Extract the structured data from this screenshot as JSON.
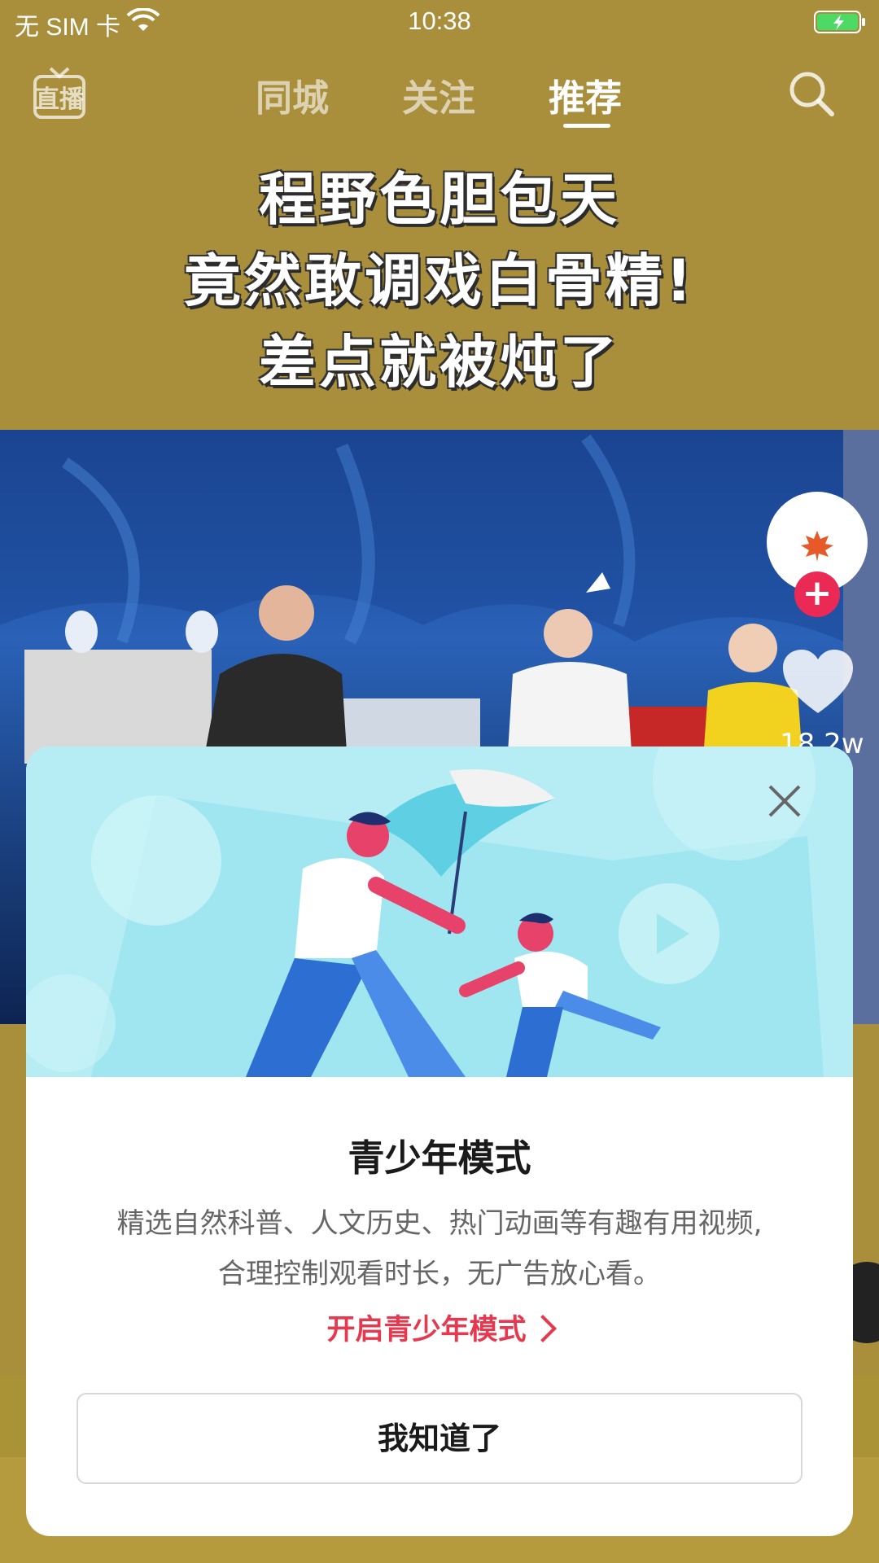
{
  "status_bar": {
    "carrier": "无 SIM 卡",
    "time": "10:38",
    "battery": "charging"
  },
  "top_nav": {
    "live_icon_label": "直播",
    "tabs": [
      {
        "label": "同城",
        "active": false
      },
      {
        "label": "关注",
        "active": false
      },
      {
        "label": "推荐",
        "active": true
      }
    ]
  },
  "video": {
    "headline_lines": [
      "程野色胆包天",
      "竟然敢调戏白骨精!",
      "差点就被炖了"
    ]
  },
  "side_actions": {
    "like_count": "18.2w"
  },
  "teen_mode_modal": {
    "title": "青少年模式",
    "description_line1": "精选自然科普、人文历史、热门动画等有趣有用视频,",
    "description_line2": "合理控制观看时长，无广告放心看。",
    "enable_link": "开启青少年模式",
    "dismiss_button": "我知道了"
  },
  "colors": {
    "background": "#a98f3c",
    "accent_red": "#e6394f",
    "follow_red": "#ea2a55",
    "illustration_bg": "#b9eef5"
  }
}
